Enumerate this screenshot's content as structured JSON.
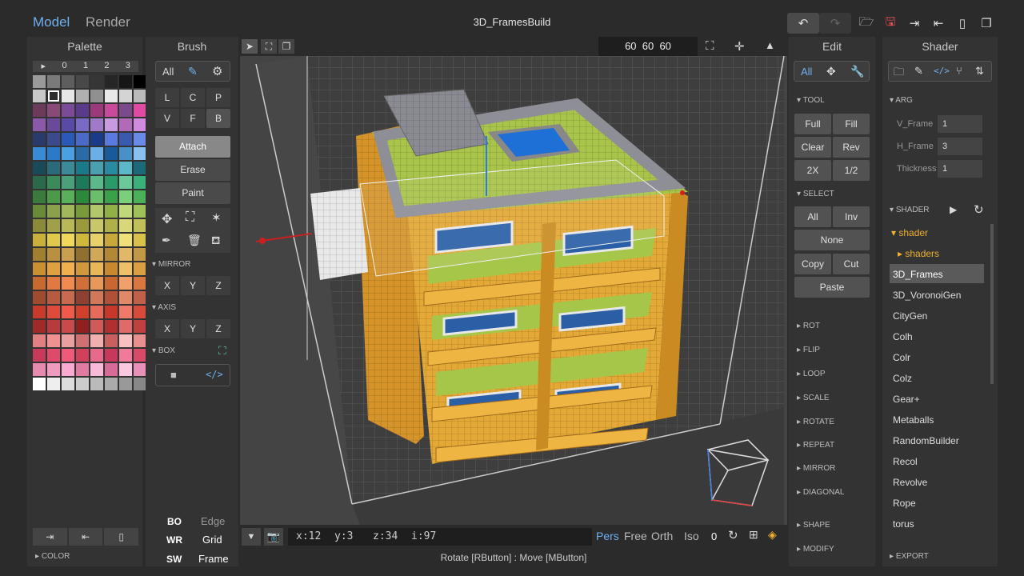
{
  "app": {
    "mode_model": "Model",
    "mode_render": "Render",
    "title": "3D_FramesBuild"
  },
  "palette": {
    "title": "Palette",
    "tabs": [
      "▸",
      "0",
      "1",
      "2",
      "3"
    ],
    "color_section": "COLOR"
  },
  "brush": {
    "title": "Brush",
    "all": "All",
    "shape_row1": [
      "L",
      "C",
      "P"
    ],
    "shape_row2": [
      "V",
      "F",
      "B"
    ],
    "actions": [
      "Attach",
      "Erase",
      "Paint"
    ],
    "mirror": "MIRROR",
    "axis": "AXIS",
    "box": "BOX",
    "xyz": [
      "X",
      "Y",
      "Z"
    ],
    "bo": "BO",
    "edge": "Edge",
    "wr": "WR",
    "grid": "Grid",
    "sw": "SW",
    "frame": "Frame"
  },
  "viewport": {
    "dims": "60  60  60",
    "coords": {
      "x": "x:12",
      "y": "y:3",
      "z": "z:34",
      "i": "i:97"
    },
    "views": [
      "Pers",
      "Free",
      "Orth",
      "Iso"
    ],
    "zero": "0",
    "status": "Rotate [RButton] : Move [MButton]"
  },
  "edit": {
    "title": "Edit",
    "all": "All",
    "tool": "TOOL",
    "tool_btns": [
      "Full",
      "Fill",
      "Clear",
      "Rev",
      "2X",
      "1/2"
    ],
    "select": "SELECT",
    "select_btns": [
      "All",
      "Inv",
      "None",
      "Copy",
      "Cut",
      "Paste"
    ],
    "sections": [
      "ROT",
      "FLIP",
      "LOOP",
      "SCALE",
      "ROTATE",
      "REPEAT",
      "MIRROR",
      "DIAGONAL",
      "SHAPE",
      "MODIFY"
    ]
  },
  "shader": {
    "title": "Shader",
    "arg": "ARG",
    "args": [
      {
        "label": "V_Frame",
        "value": "1"
      },
      {
        "label": "H_Frame",
        "value": "3"
      },
      {
        "label": "Thickness",
        "value": "1"
      }
    ],
    "shader_section": "SHADER",
    "folder": "shader",
    "subfolder": "shaders",
    "items": [
      "3D_Frames",
      "3D_VoronoiGen",
      "CityGen",
      "Colh",
      "Colr",
      "Colz",
      "Gear+",
      "Metaballs",
      "RandomBuilder",
      "Recol",
      "Revolve",
      "Rope",
      "torus"
    ],
    "export": "EXPORT"
  }
}
